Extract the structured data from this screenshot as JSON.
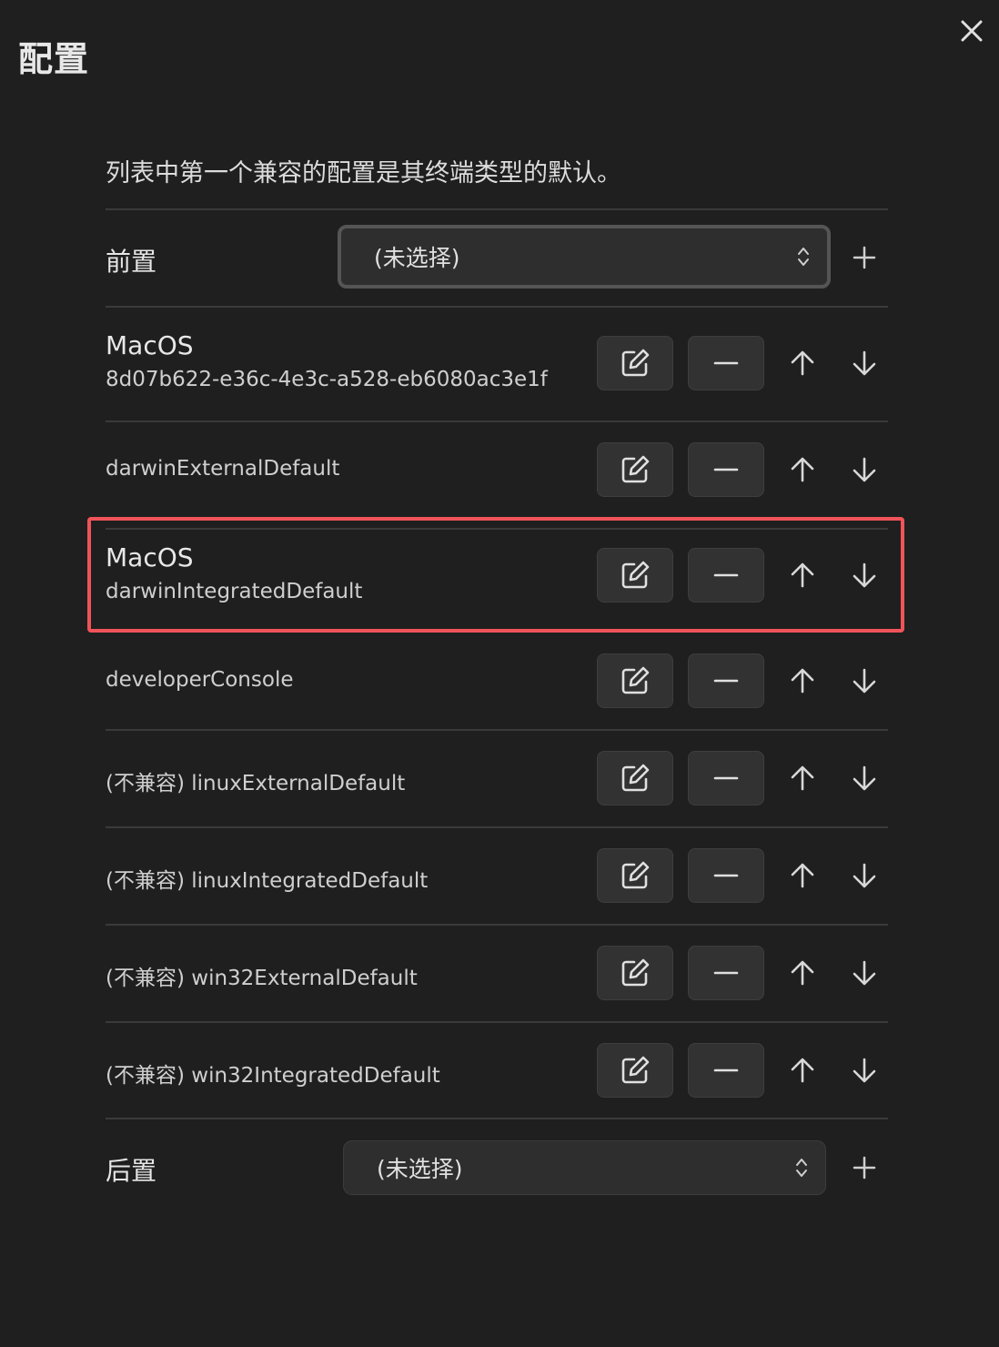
{
  "dialog": {
    "title": "配置",
    "description": "列表中第一个兼容的配置是其终端类型的默认。"
  },
  "prefix": {
    "label": "前置",
    "selected": "(未选择)"
  },
  "suffix": {
    "label": "后置",
    "selected": "(未选择)"
  },
  "profiles": [
    {
      "name": "MacOS",
      "id": "8d07b622-e36c-4e3c-a528-eb6080ac3e1f"
    },
    {
      "name": "",
      "id": "darwinExternalDefault"
    },
    {
      "name": "MacOS",
      "id": "darwinIntegratedDefault"
    },
    {
      "name": "",
      "id": "developerConsole"
    },
    {
      "name": "",
      "id": "(不兼容) linuxExternalDefault"
    },
    {
      "name": "",
      "id": "(不兼容) linuxIntegratedDefault"
    },
    {
      "name": "",
      "id": "(不兼容) win32ExternalDefault"
    },
    {
      "name": "",
      "id": "(不兼容) win32IntegratedDefault"
    }
  ],
  "colors": {
    "background": "#1f1f1f",
    "button": "#323232",
    "highlight": "#f0545a"
  }
}
